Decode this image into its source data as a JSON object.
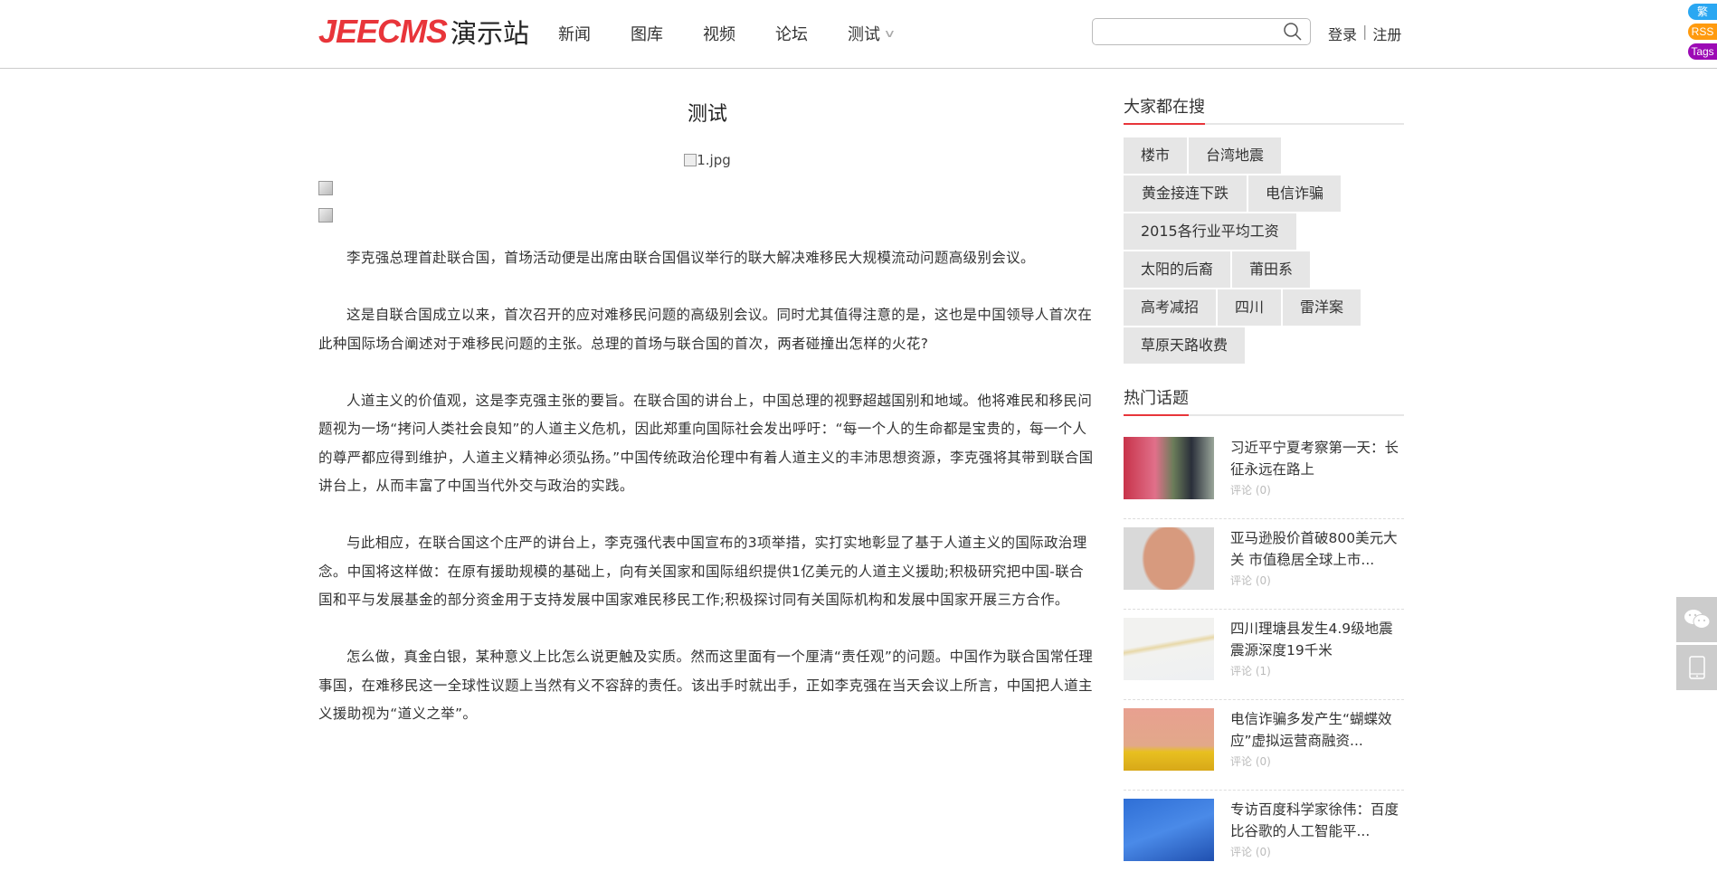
{
  "header": {
    "logo_en": "JEECMS",
    "logo_cn": "演示站",
    "nav": [
      "新闻",
      "图库",
      "视频",
      "论坛",
      "测试"
    ],
    "search_placeholder": "",
    "login": "登录",
    "sep": "|",
    "register": "注册"
  },
  "badges": [
    {
      "label": "繁",
      "color": "#2aa7f2"
    },
    {
      "label": "RSS",
      "color": "#ff9a0e"
    },
    {
      "label": "Tags",
      "color": "#9c0ab5"
    }
  ],
  "article": {
    "title": "测试",
    "image_alt": "1.jpg",
    "paragraphs": [
      "李克强总理首赴联合国，首场活动便是出席由联合国倡议举行的联大解决难移民大规模流动问题高级别会议。",
      "这是自联合国成立以来，首次召开的应对难移民问题的高级别会议。同时尤其值得注意的是，这也是中国领导人首次在此种国际场合阐述对于难移民问题的主张。总理的首场与联合国的首次，两者碰撞出怎样的火花?",
      "人道主义的价值观，这是李克强主张的要旨。在联合国的讲台上，中国总理的视野超越国别和地域。他将难民和移民问题视为一场“拷问人类社会良知”的人道主义危机，因此郑重向国际社会发出呼吁：“每一个人的生命都是宝贵的，每一个人的尊严都应得到维护，人道主义精神必须弘扬。”中国传统政治伦理中有着人道主义的丰沛思想资源，李克强将其带到联合国讲台上，从而丰富了中国当代外交与政治的实践。",
      "与此相应，在联合国这个庄严的讲台上，李克强代表中国宣布的3项举措，实打实地彰显了基于人道主义的国际政治理念。中国将这样做：在原有援助规模的基础上，向有关国家和国际组织提供1亿美元的人道主义援助;积极研究把中国-联合国和平与发展基金的部分资金用于支持发展中国家难民移民工作;积极探讨同有关国际机构和发展中国家开展三方合作。",
      "怎么做，真金白银，某种意义上比怎么说更触及实质。然而这里面有一个厘清“责任观”的问题。中国作为联合国常任理事国，在难移民这一全球性议题上当然有义不容辞的责任。该出手时就出手，正如李克强在当天会议上所言，中国把人道主义援助视为“道义之举”。"
    ]
  },
  "sidebar": {
    "search_title": "大家都在搜",
    "tags": [
      "楼市",
      "台湾地震",
      "黄金接连下跌",
      "电信诈骗",
      "2015各行业平均工资",
      "太阳的后裔",
      "莆田系",
      "高考减招",
      "四川",
      "雷洋案",
      "草原天路收费"
    ],
    "hot_title": "热门话题",
    "hot": [
      {
        "title": "习近平宁夏考察第一天：长征永远在路上",
        "comments": "评论 (0)"
      },
      {
        "title": "亚马逊股价首破800美元大关 市值稳居全球上市...",
        "comments": "评论 (0)"
      },
      {
        "title": "四川理塘县发生4.9级地震 震源深度19千米",
        "comments": "评论 (1)"
      },
      {
        "title": "电信诈骗多发产生“蝴蝶效应”虚拟运营商融资...",
        "comments": "评论 (0)"
      },
      {
        "title": "专访百度科学家徐伟：百度比谷歌的人工智能平...",
        "comments": "评论 (0)"
      }
    ]
  }
}
